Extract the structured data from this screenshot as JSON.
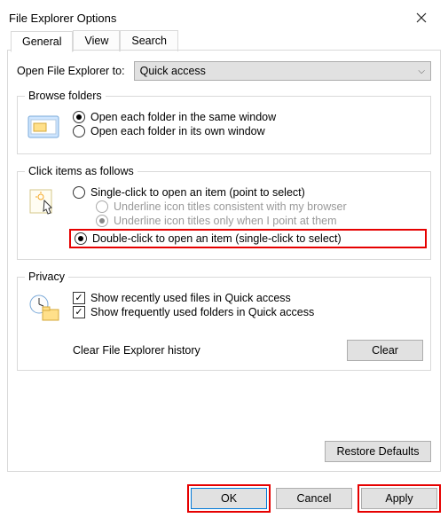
{
  "title": "File Explorer Options",
  "tabs": {
    "general": "General",
    "view": "View",
    "search": "Search"
  },
  "open_to_label": "Open File Explorer to:",
  "open_to_value": "Quick access",
  "browse": {
    "legend": "Browse folders",
    "same": "Open each folder in the same window",
    "own": "Open each folder in its own window"
  },
  "click": {
    "legend": "Click items as follows",
    "single": "Single-click to open an item (point to select)",
    "ul_browser": "Underline icon titles consistent with my browser",
    "ul_point": "Underline icon titles only when I point at them",
    "double": "Double-click to open an item (single-click to select)"
  },
  "privacy": {
    "legend": "Privacy",
    "recent": "Show recently used files in Quick access",
    "frequent": "Show frequently used folders in Quick access",
    "clear_label": "Clear File Explorer history",
    "clear_btn": "Clear"
  },
  "restore": "Restore Defaults",
  "ok": "OK",
  "cancel": "Cancel",
  "apply": "Apply"
}
